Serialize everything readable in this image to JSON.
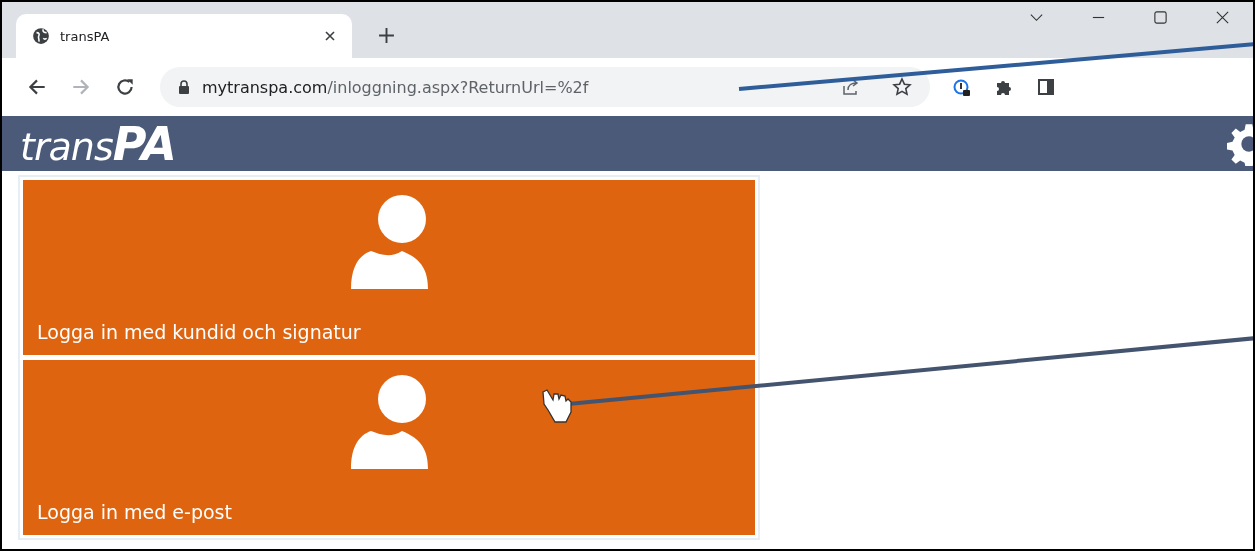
{
  "browser": {
    "tab": {
      "title": "transPA",
      "selected": true
    },
    "url": {
      "host": "mytranspa.com",
      "path": "/inloggning.aspx?ReturnUrl=%2f"
    }
  },
  "header": {
    "logo": "trans**PA**"
  },
  "login_options": [
    {
      "label": "Logga in med kundid och signatur"
    },
    {
      "label": "Logga in med e-post"
    }
  ]
}
